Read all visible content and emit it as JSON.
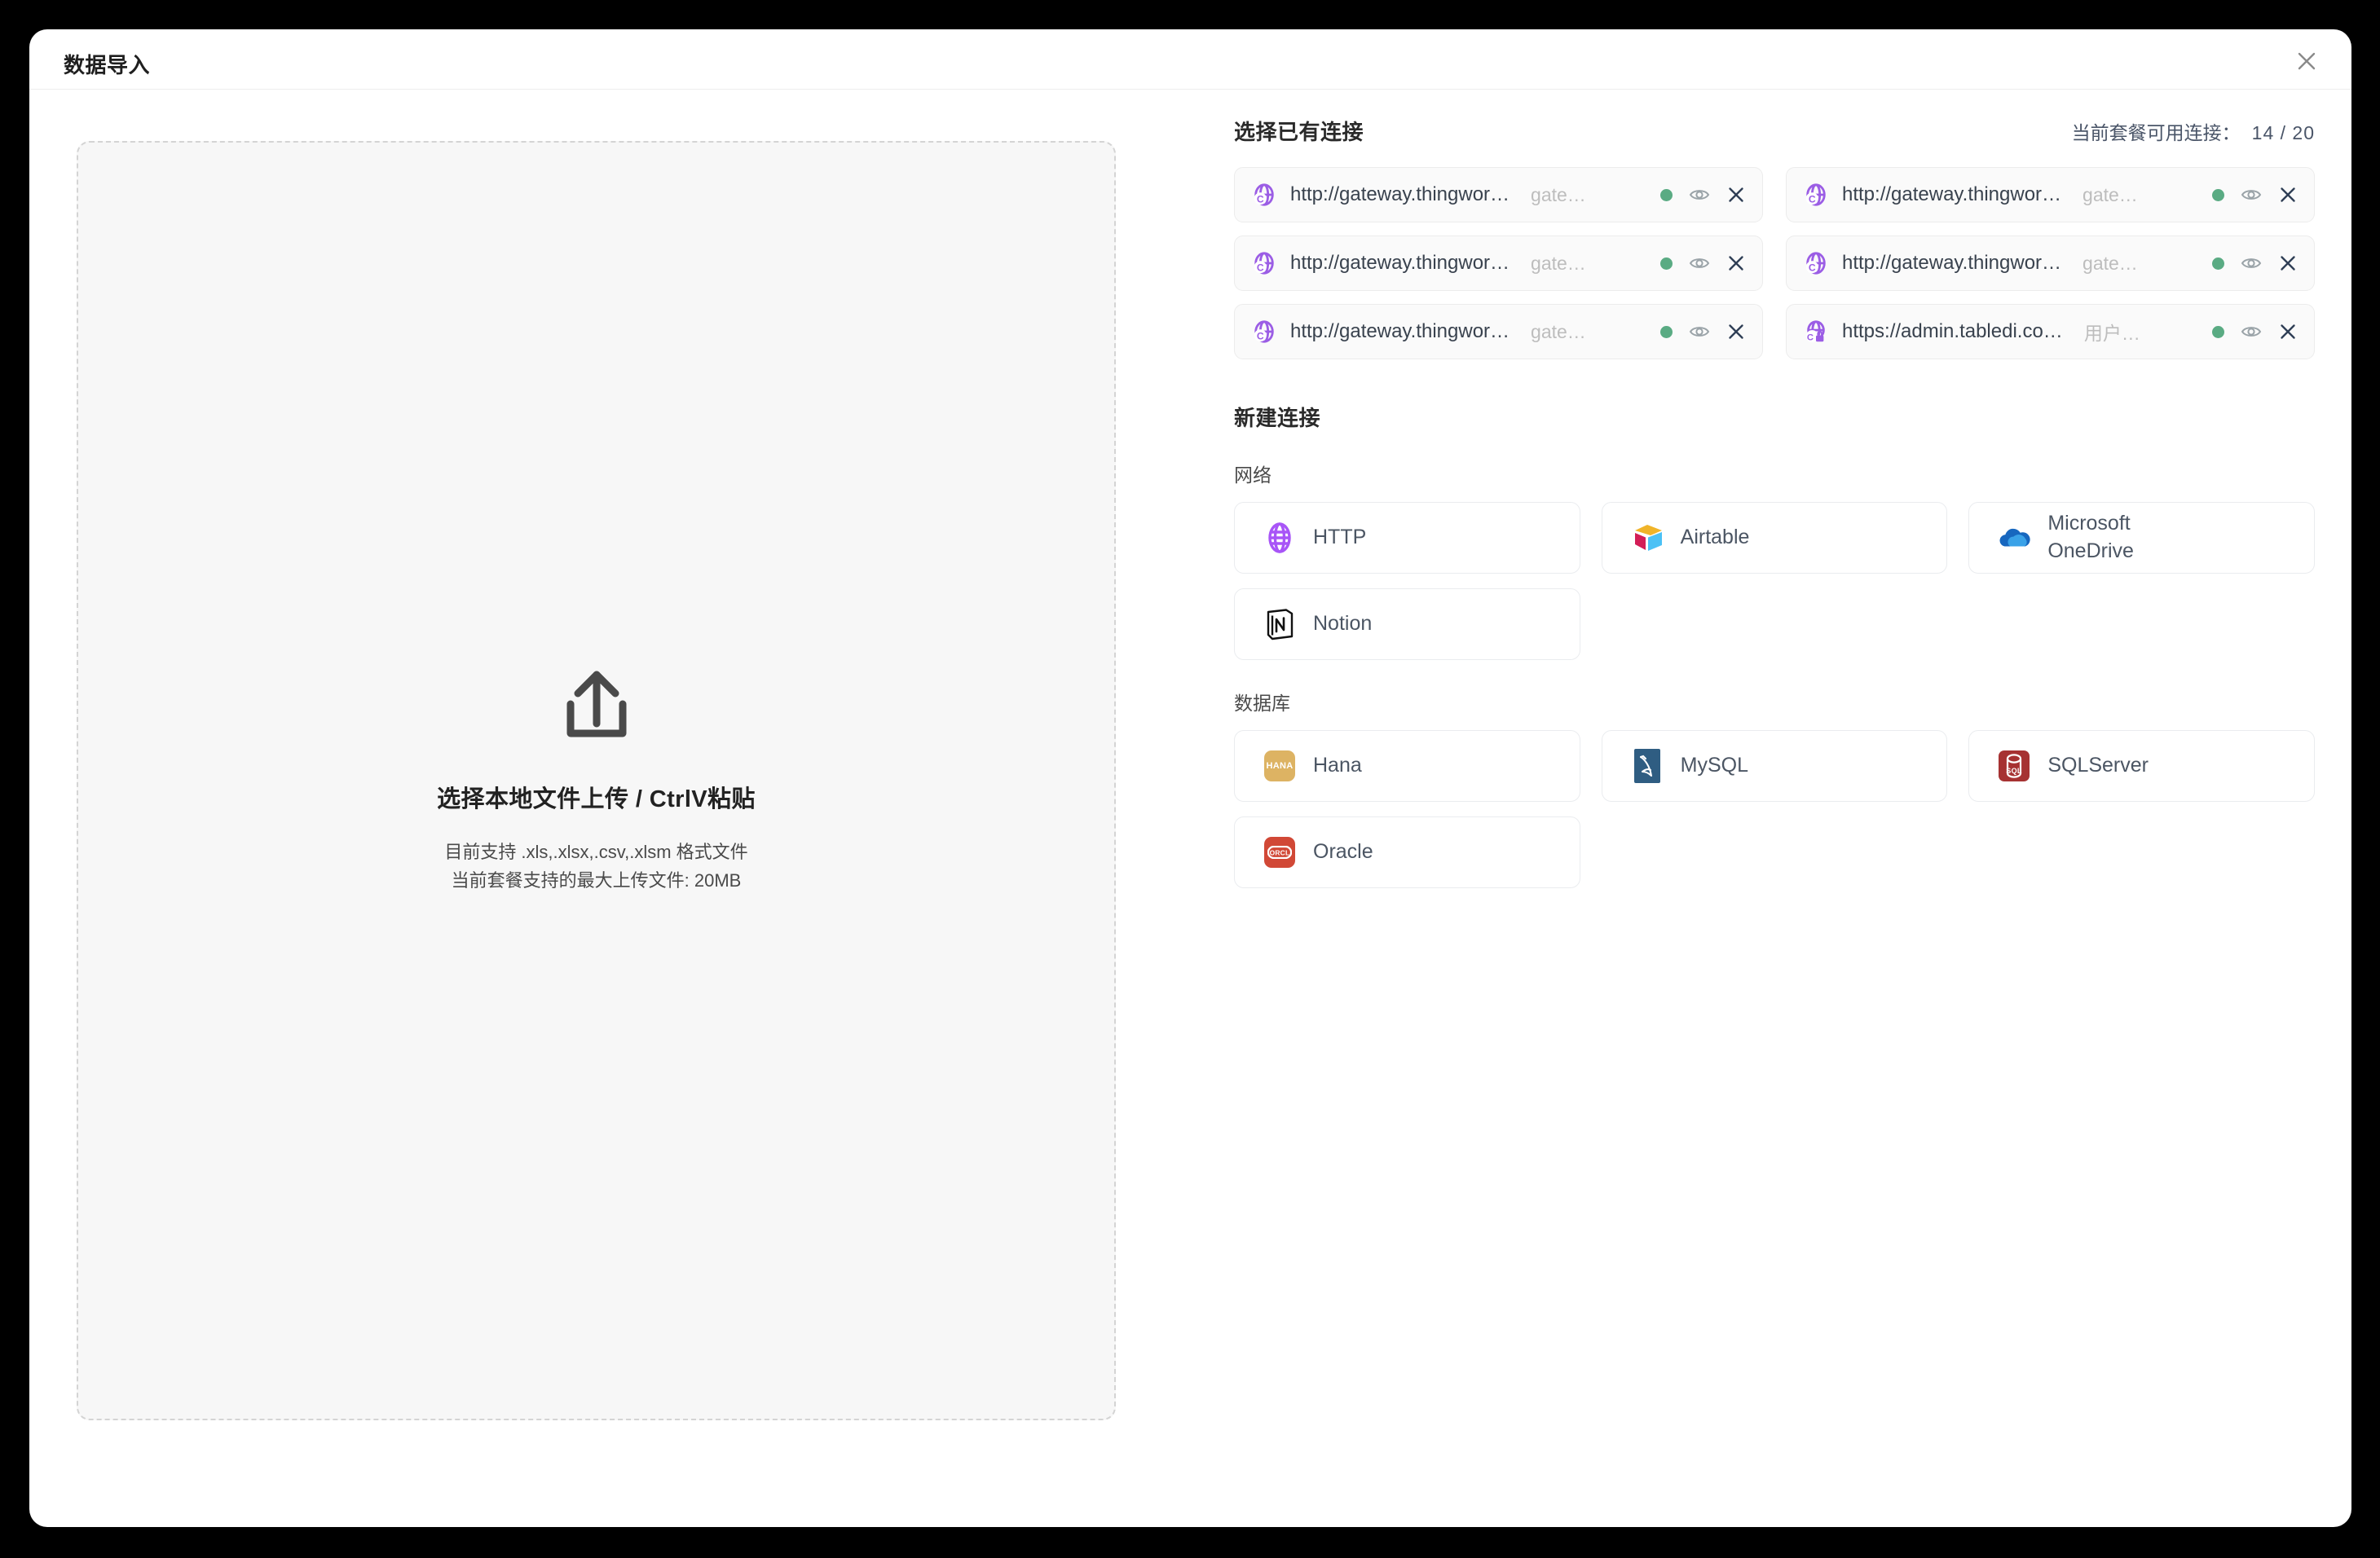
{
  "dialog": {
    "title": "数据导入",
    "close_label": "×"
  },
  "upload": {
    "icon": "upload-arrow-icon",
    "title": "选择本地文件上传 / CtrlV粘贴",
    "formats_line": "目前支持 .xls,.xlsx,.csv,.xlsm 格式文件",
    "size_line": "当前套餐支持的最大上传文件: 20MB"
  },
  "existing": {
    "title": "选择已有连接",
    "quota_label": "当前套餐可用连接：",
    "quota_value": "14 / 20",
    "connections": [
      {
        "icon": "globe-c-icon",
        "url": "http://gateway.thingwor…",
        "label": "gate…",
        "status": "online",
        "status_color": "#5aab83"
      },
      {
        "icon": "globe-c-icon",
        "url": "http://gateway.thingwor…",
        "label": "gate…",
        "status": "online",
        "status_color": "#5aab83"
      },
      {
        "icon": "globe-c-icon",
        "url": "http://gateway.thingwor…",
        "label": "gate…",
        "status": "online",
        "status_color": "#5aab83"
      },
      {
        "icon": "globe-c-icon",
        "url": "http://gateway.thingwor…",
        "label": "gate…",
        "status": "online",
        "status_color": "#5aab83"
      },
      {
        "icon": "globe-c-icon",
        "url": "http://gateway.thingwor…",
        "label": "gate…",
        "status": "online",
        "status_color": "#5aab83"
      },
      {
        "icon": "globe-lock-icon",
        "url": "https://admin.tabledi.co…",
        "label": "用户…",
        "status": "online",
        "status_color": "#5aab83"
      }
    ],
    "action_icons": {
      "eye": "eye-icon",
      "remove": "close-icon"
    }
  },
  "new_connection": {
    "title": "新建连接",
    "groups": [
      {
        "label": "网络",
        "items": [
          {
            "name": "HTTP",
            "icon": "http-globe-icon",
            "color": "#9b5de5"
          },
          {
            "name": "Airtable",
            "icon": "airtable-icon",
            "color": "#fcb400"
          },
          {
            "name": "Microsoft\nOneDrive",
            "icon": "onedrive-icon",
            "color": "#0f6cbd"
          },
          {
            "name": "Notion",
            "icon": "notion-icon",
            "color": "#000000"
          }
        ]
      },
      {
        "label": "数据库",
        "items": [
          {
            "name": "Hana",
            "icon": "hana-icon",
            "color": "#ddb363",
            "badge_text": "HANA"
          },
          {
            "name": "MySQL",
            "icon": "mysql-icon",
            "color": "#2f5d82"
          },
          {
            "name": "SQLServer",
            "icon": "sqlserver-icon",
            "color": "#a63232"
          },
          {
            "name": "Oracle",
            "icon": "oracle-icon",
            "color": "#d14836",
            "badge_text": "ORCL"
          }
        ]
      }
    ]
  }
}
